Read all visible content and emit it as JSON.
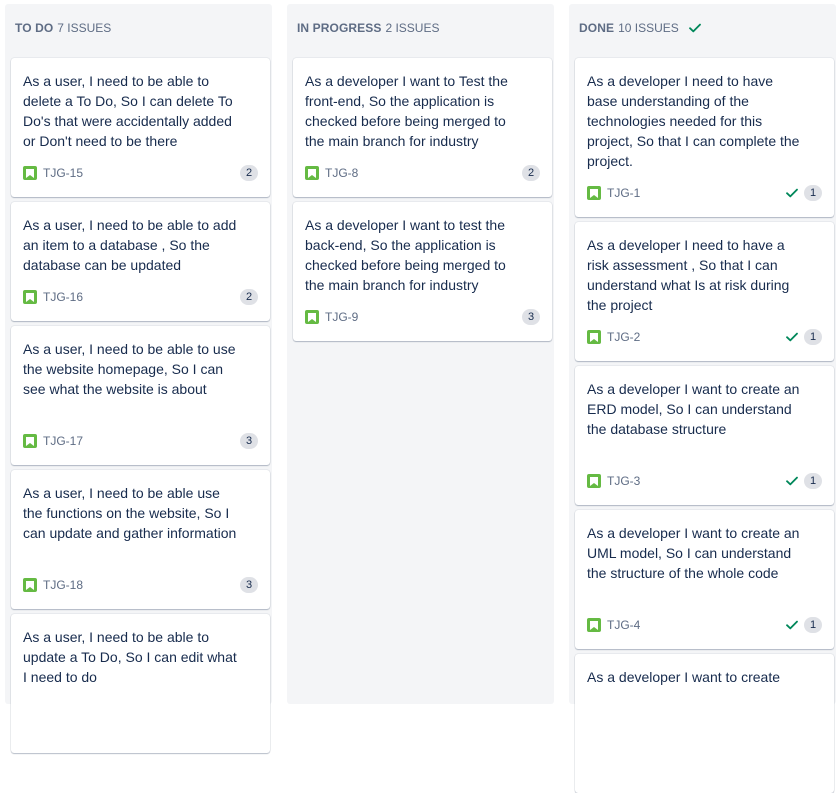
{
  "colors": {
    "story": "#65ba43",
    "done_check": "#00875a",
    "column_bg": "#f4f5f7"
  },
  "columns": [
    {
      "name": "TO DO",
      "count": "7 ISSUES",
      "done": false,
      "cards": [
        {
          "summary": "As a user, I need to be able to delete a To Do, So I can delete To Do's that were accidentally added or Don't need to be there",
          "key": "TJG-15",
          "estimate": "2",
          "icon": "story-icon"
        },
        {
          "summary": "As a user, I need to be able to add an item to a database , So the database can be updated",
          "key": "TJG-16",
          "estimate": "2",
          "icon": "story-icon"
        },
        {
          "summary": "As a user, I need to be able to use the website homepage, So I can see what the website is about",
          "key": "TJG-17",
          "estimate": "3",
          "icon": "story-icon"
        },
        {
          "summary": "As a user, I need to be able use the functions on the website, So I can update and gather information",
          "key": "TJG-18",
          "estimate": "3",
          "icon": "story-icon"
        },
        {
          "summary": "As a user, I need to be able to update a To Do, So I can edit what I need to do",
          "key": "",
          "estimate": "",
          "icon": "story-icon"
        }
      ]
    },
    {
      "name": "IN PROGRESS",
      "count": "2 ISSUES",
      "done": false,
      "cards": [
        {
          "summary": "As a developer I want to Test the front-end, So the application is checked before being merged to the main branch for industry",
          "key": "TJG-8",
          "estimate": "2",
          "icon": "story-icon"
        },
        {
          "summary": "As a developer I want to test the back-end, So the application is checked before being merged to the main branch for industry",
          "key": "TJG-9",
          "estimate": "3",
          "icon": "story-icon"
        }
      ]
    },
    {
      "name": "DONE",
      "count": "10 ISSUES",
      "done": true,
      "cards": [
        {
          "summary": "As a developer I need to have base understanding of the technologies needed for this project, So that I can complete the project.",
          "key": "TJG-1",
          "estimate": "1",
          "icon": "story-icon"
        },
        {
          "summary": "As a developer I need to have a risk assessment , So that I can understand what Is at risk during the project",
          "key": "TJG-2",
          "estimate": "1",
          "icon": "story-icon"
        },
        {
          "summary": "As a developer I want to create an ERD model, So I can understand the database structure",
          "key": "TJG-3",
          "estimate": "1",
          "icon": "story-icon"
        },
        {
          "summary": "As a developer I want to create an UML model, So I can understand the structure of the whole code",
          "key": "TJG-4",
          "estimate": "1",
          "icon": "story-icon"
        },
        {
          "summary": "As a developer I want to create",
          "key": "",
          "estimate": "",
          "icon": "story-icon"
        }
      ]
    }
  ]
}
